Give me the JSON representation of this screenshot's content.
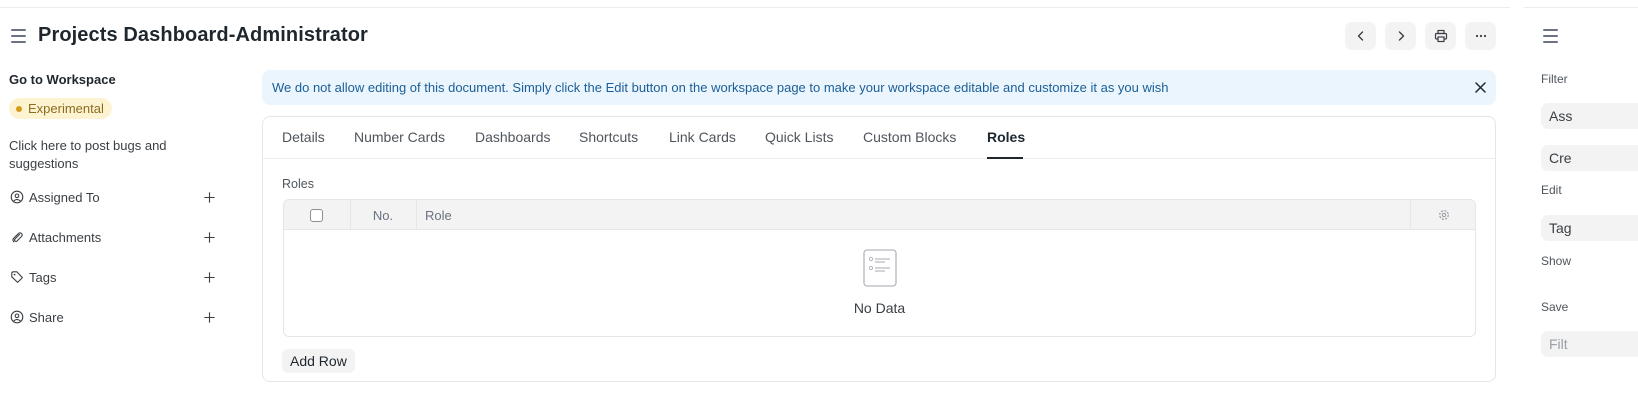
{
  "header": {
    "title": "Projects Dashboard-Administrator"
  },
  "sidebar": {
    "goto_label": "Go to Workspace",
    "badge_label": "Experimental",
    "bug_link": "Click here to post bugs and suggestions",
    "items": [
      {
        "label": "Assigned To",
        "icon": "assign-icon"
      },
      {
        "label": "Attachments",
        "icon": "paperclip-icon"
      },
      {
        "label": "Tags",
        "icon": "tag-icon"
      },
      {
        "label": "Share",
        "icon": "share-icon"
      }
    ]
  },
  "alert": {
    "text": "We do not allow editing of this document. Simply click the Edit button on the workspace page to make your workspace editable and customize it as you wish"
  },
  "tabs": [
    {
      "label": "Details"
    },
    {
      "label": "Number Cards"
    },
    {
      "label": "Dashboards"
    },
    {
      "label": "Shortcuts"
    },
    {
      "label": "Link Cards"
    },
    {
      "label": "Quick Lists"
    },
    {
      "label": "Custom Blocks"
    },
    {
      "label": "Roles",
      "active": true
    }
  ],
  "roles_section": {
    "label": "Roles",
    "columns": [
      "No.",
      "Role"
    ],
    "empty_text": "No Data",
    "add_row_label": "Add Row"
  },
  "right_panel": {
    "labels": [
      "Filter",
      "Edit",
      "Show",
      "Save"
    ],
    "inputs": [
      "Ass",
      "Cre",
      "Tag",
      "Filt"
    ]
  },
  "colors": {
    "alert_bg": "#eaf5fd",
    "alert_text": "#1c5e97",
    "badge_bg": "#fdf3d1",
    "badge_dot": "#d59b1a"
  }
}
